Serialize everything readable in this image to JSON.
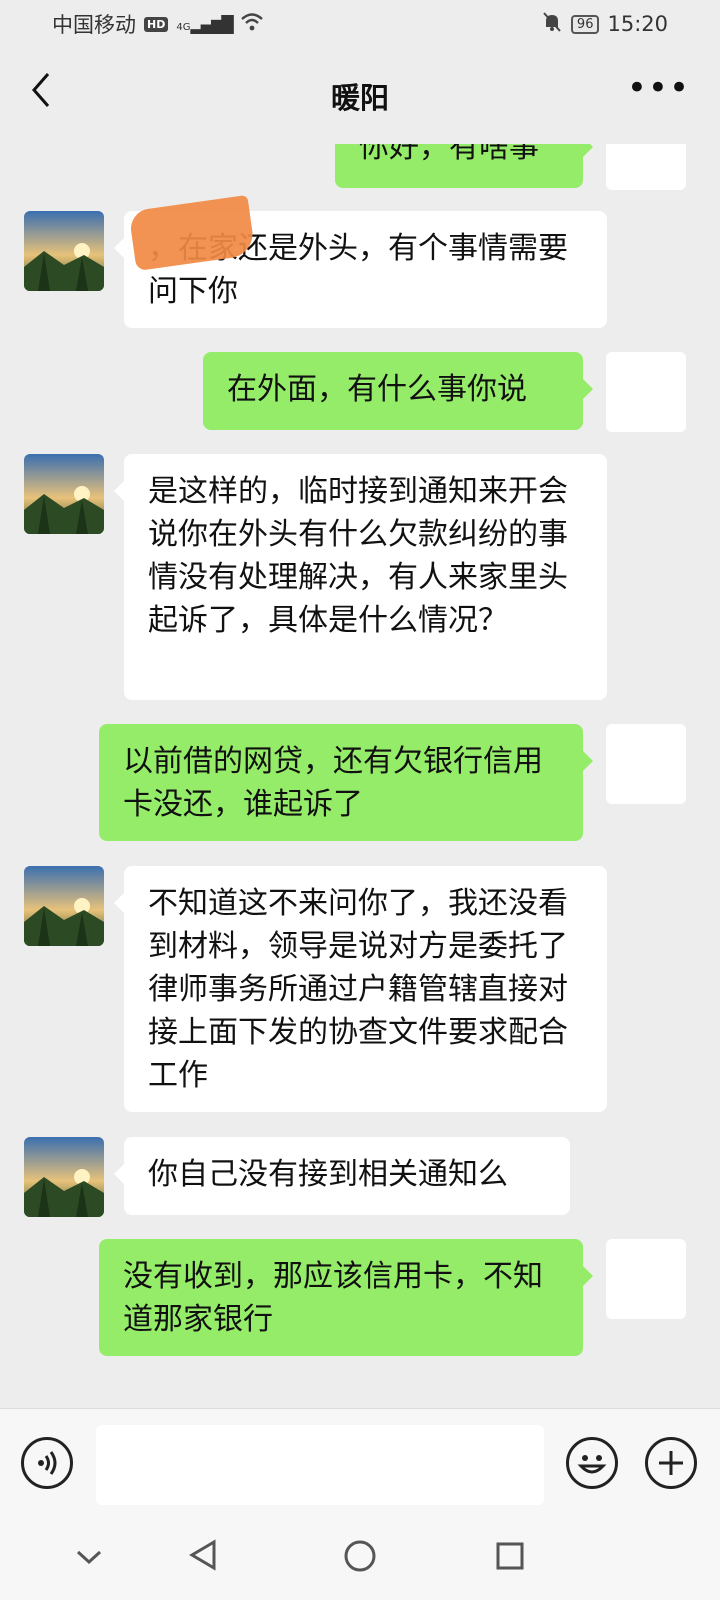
{
  "status_bar": {
    "carrier": "中国移动",
    "network_badge": "HD",
    "signal": "4G",
    "battery": "96",
    "time": "15:20",
    "icons": [
      "hd-icon",
      "signal-icon",
      "wifi-icon",
      "mute-icon",
      "battery-icon"
    ]
  },
  "header": {
    "title": "暖阳",
    "back_icon": "chevron-left-icon",
    "more_icon": "more-icon"
  },
  "messages": [
    {
      "side": "out",
      "text": "你好，有啥事"
    },
    {
      "side": "in",
      "text": "，在家还是外头，有个事情需要问下你",
      "redacted": true
    },
    {
      "side": "out",
      "text": "在外面，有什么事你说"
    },
    {
      "side": "in",
      "text": "是这样的，临时接到通知来开会说你在外头有什么欠款纠纷的事情没有处理解决，有人来家里头起诉了，具体是什么情况？"
    },
    {
      "side": "out",
      "text": "以前借的网贷，还有欠银行信用卡没还，谁起诉了"
    },
    {
      "side": "in",
      "text": "不知道这不来问你了，我还没看到材料，领导是说对方是委托了律师事务所通过户籍管辖直接对接上面下发的协查文件要求配合工作"
    },
    {
      "side": "in",
      "text": "你自己没有接到相关通知么"
    },
    {
      "side": "out",
      "text": "没有收到，那应该信用卡，不知道那家银行"
    }
  ],
  "input_bar": {
    "placeholder": "",
    "icons": [
      "voice-icon",
      "emoji-icon",
      "plus-icon"
    ]
  },
  "nav_bar": {
    "icons": [
      "collapse-icon",
      "back-triangle-icon",
      "home-circle-icon",
      "recents-square-icon"
    ]
  },
  "colors": {
    "background": "#ededed",
    "outgoing_bubble": "#95ec69",
    "incoming_bubble": "#ffffff",
    "redaction": "#f28a44"
  }
}
